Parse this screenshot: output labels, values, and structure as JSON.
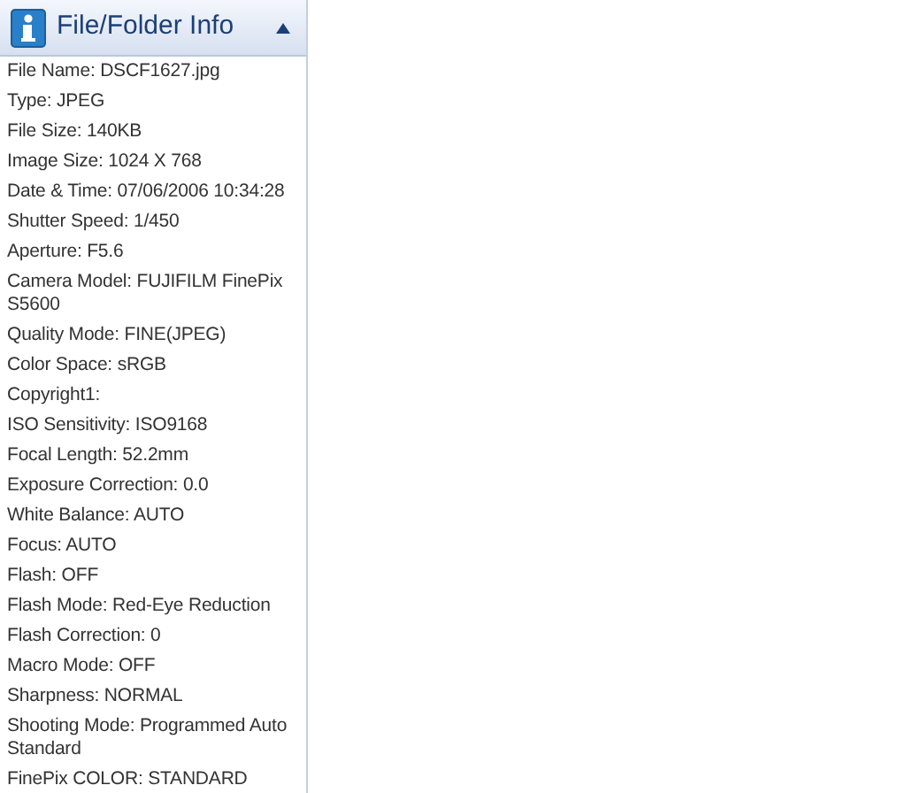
{
  "panel": {
    "title": "File/Folder Info",
    "expanded": true,
    "rows": [
      "File Name: DSCF1627.jpg",
      "Type: JPEG",
      "File Size: 140KB",
      "Image Size: 1024 X 768",
      "Date & Time: 07/06/2006 10:34:28",
      "Shutter Speed: 1/450",
      "Aperture: F5.6",
      "Camera Model: FUJIFILM FinePix S5600",
      "Quality Mode: FINE(JPEG)",
      "Color Space: sRGB",
      "Copyright1:",
      "ISO Sensitivity: ISO9168",
      "Focal Length: 52.2mm",
      "Exposure Correction: 0.0",
      "White Balance: AUTO",
      "Focus: AUTO",
      "Flash: OFF",
      "Flash Mode: Red-Eye Reduction",
      "Flash Correction: 0",
      "Macro Mode: OFF",
      "Sharpness: NORMAL",
      "Shooting Mode: Programmed Auto Standard",
      "FinePix COLOR: STANDARD"
    ]
  }
}
